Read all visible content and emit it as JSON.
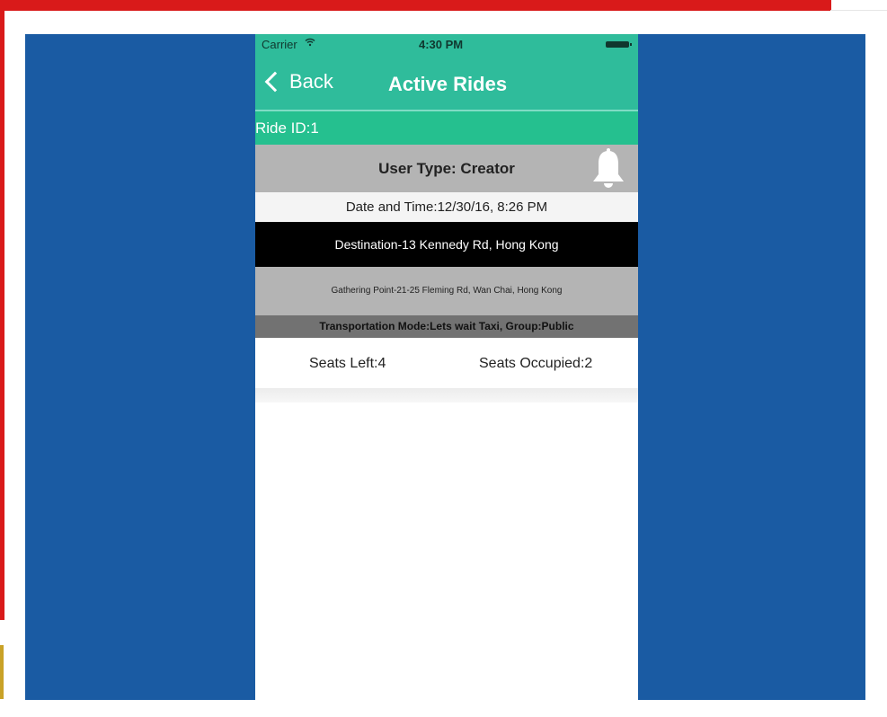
{
  "status_bar": {
    "carrier": "Carrier",
    "time": "4:30 PM"
  },
  "nav": {
    "back_label": "Back",
    "title": "Active Rides"
  },
  "ride": {
    "id_label": "Ride ID:1",
    "user_type": "User Type: Creator",
    "date_time": "Date and Time:12/30/16, 8:26 PM",
    "destination": "Destination-13 Kennedy Rd, Hong Kong",
    "gathering_point": "Gathering Point-21-25 Fleming Rd, Wan Chai, Hong Kong",
    "transport": "Transportation Mode:Lets wait Taxi,  Group:Public",
    "seats_left": "Seats Left:4",
    "seats_occupied": "Seats Occupied:2"
  },
  "icons": [
    "wifi-icon",
    "battery-icon",
    "chevron-left-icon",
    "bell-icon"
  ],
  "colors": {
    "nav_green": "#2fbc9b",
    "ride_id_green": "#25c08f",
    "backdrop_blue": "#1a5ba3",
    "frame_red": "#d91a1a"
  }
}
